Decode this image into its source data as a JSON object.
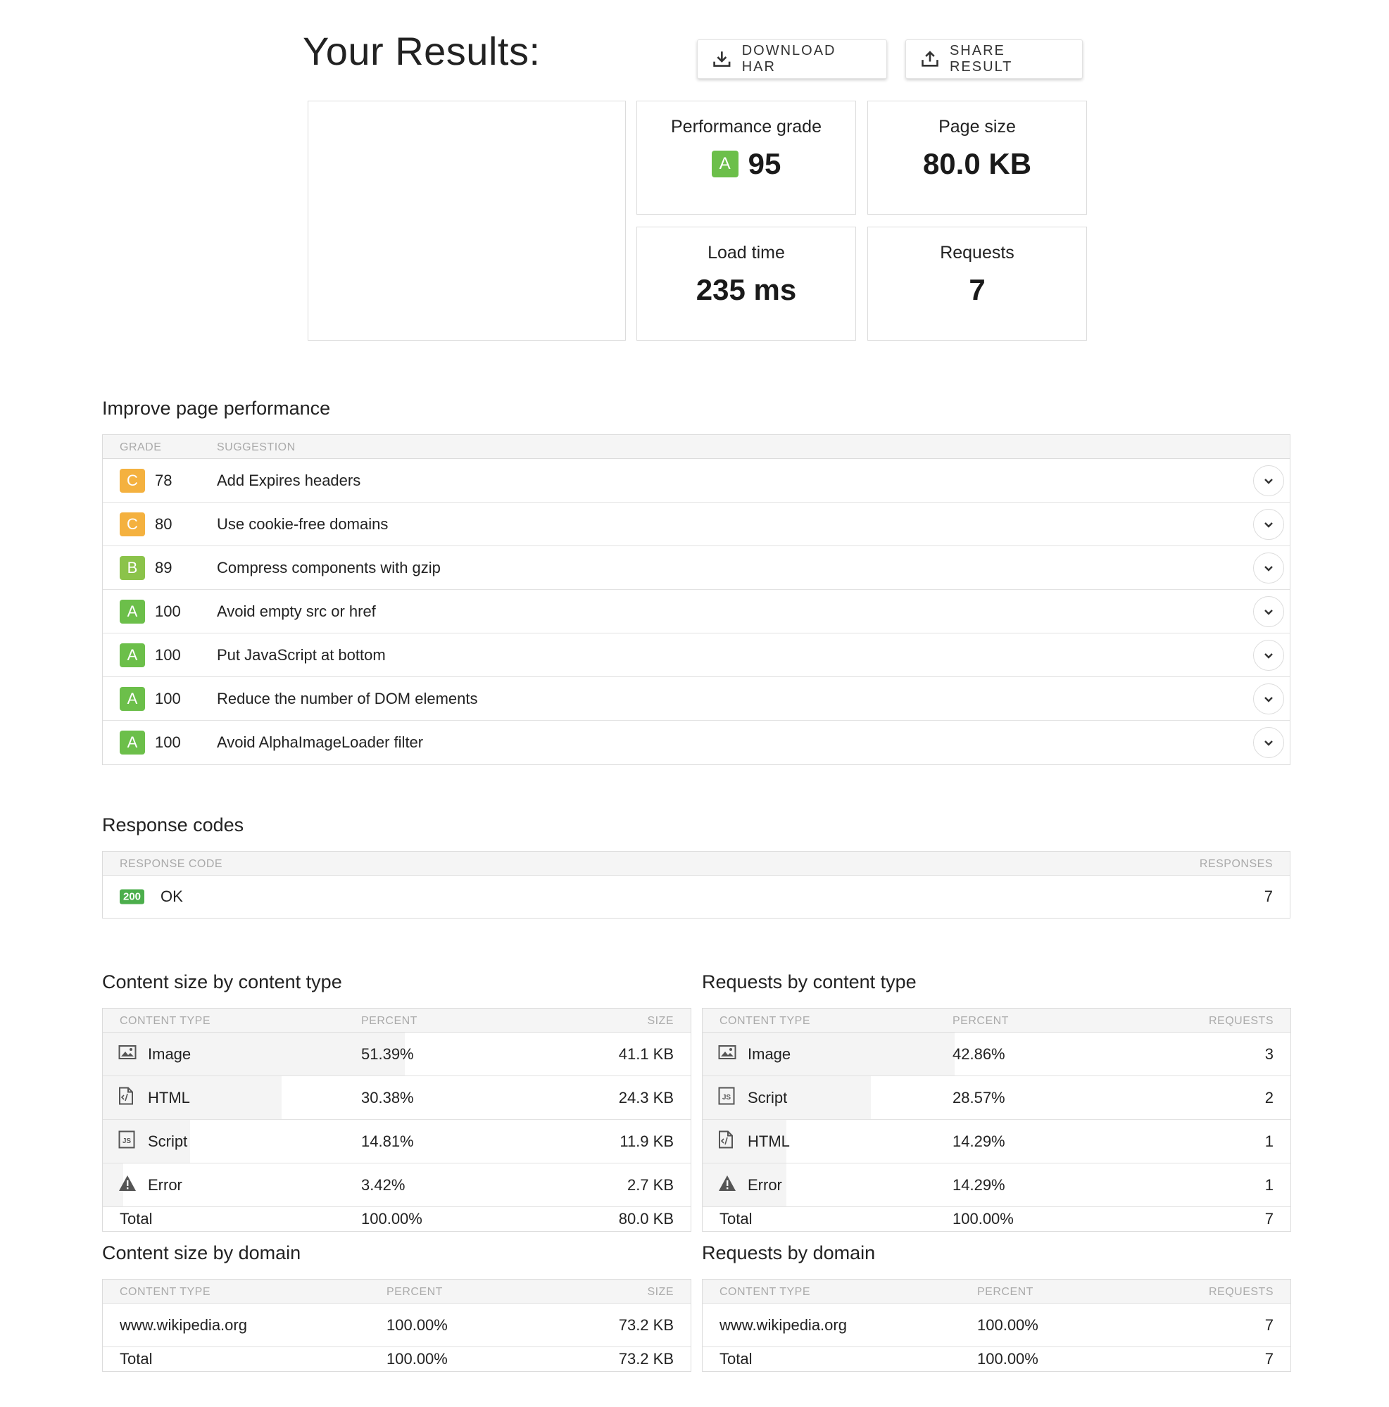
{
  "header": {
    "title": "Your Results:",
    "download_label": "DOWNLOAD HAR",
    "share_label": "SHARE RESULT"
  },
  "summary": {
    "grade_label": "Performance grade",
    "grade_letter": "A",
    "grade_value": "95",
    "size_label": "Page size",
    "size_value": "80.0 KB",
    "load_label": "Load time",
    "load_value": "235 ms",
    "requests_label": "Requests",
    "requests_value": "7"
  },
  "improve": {
    "title": "Improve page performance",
    "col_grade": "GRADE",
    "col_suggestion": "SUGGESTION",
    "rows": [
      {
        "letter": "C",
        "score": "78",
        "text": "Add Expires headers"
      },
      {
        "letter": "C",
        "score": "80",
        "text": "Use cookie-free domains"
      },
      {
        "letter": "B",
        "score": "89",
        "text": "Compress components with gzip"
      },
      {
        "letter": "A",
        "score": "100",
        "text": "Avoid empty src or href"
      },
      {
        "letter": "A",
        "score": "100",
        "text": "Put JavaScript at bottom"
      },
      {
        "letter": "A",
        "score": "100",
        "text": "Reduce the number of DOM elements"
      },
      {
        "letter": "A",
        "score": "100",
        "text": "Avoid AlphaImageLoader filter"
      }
    ]
  },
  "response_codes": {
    "title": "Response codes",
    "col_code": "RESPONSE CODE",
    "col_responses": "RESPONSES",
    "rows": [
      {
        "code": "200",
        "text": "OK",
        "responses": "7"
      }
    ]
  },
  "content_size": {
    "title": "Content size by content type",
    "col_type": "CONTENT TYPE",
    "col_percent": "PERCENT",
    "col_value": "SIZE",
    "rows": [
      {
        "icon": "image-icon",
        "type": "Image",
        "percent": "51.39%",
        "value": "41.1 KB",
        "fraction": 0.5139
      },
      {
        "icon": "html-file-icon",
        "type": "HTML",
        "percent": "30.38%",
        "value": "24.3 KB",
        "fraction": 0.3038
      },
      {
        "icon": "script-file-icon",
        "type": "Script",
        "percent": "14.81%",
        "value": "11.9 KB",
        "fraction": 0.1481
      },
      {
        "icon": "warning-icon",
        "type": "Error",
        "percent": "3.42%",
        "value": "2.7 KB",
        "fraction": 0.0342
      }
    ],
    "total": {
      "label": "Total",
      "percent": "100.00%",
      "value": "80.0 KB"
    }
  },
  "content_requests": {
    "title": "Requests by content type",
    "col_type": "CONTENT TYPE",
    "col_percent": "PERCENT",
    "col_value": "REQUESTS",
    "rows": [
      {
        "icon": "image-icon",
        "type": "Image",
        "percent": "42.86%",
        "value": "3",
        "fraction": 0.4286
      },
      {
        "icon": "script-file-icon",
        "type": "Script",
        "percent": "28.57%",
        "value": "2",
        "fraction": 0.2857
      },
      {
        "icon": "html-file-icon",
        "type": "HTML",
        "percent": "14.29%",
        "value": "1",
        "fraction": 0.1429
      },
      {
        "icon": "warning-icon",
        "type": "Error",
        "percent": "14.29%",
        "value": "1",
        "fraction": 0.1429
      }
    ],
    "total": {
      "label": "Total",
      "percent": "100.00%",
      "value": "7"
    }
  },
  "domain_size": {
    "title": "Content size by domain",
    "col_type": "CONTENT TYPE",
    "col_percent": "PERCENT",
    "col_value": "SIZE",
    "rows": [
      {
        "domain": "www.wikipedia.org",
        "percent": "100.00%",
        "value": "73.2 KB",
        "fraction": 1.0
      }
    ],
    "total": {
      "label": "Total",
      "percent": "100.00%",
      "value": "73.2 KB"
    }
  },
  "domain_requests": {
    "title": "Requests by domain",
    "col_type": "CONTENT TYPE",
    "col_percent": "PERCENT",
    "col_value": "REQUESTS",
    "rows": [
      {
        "domain": "www.wikipedia.org",
        "percent": "100.00%",
        "value": "7",
        "fraction": 1.0
      }
    ],
    "total": {
      "label": "Total",
      "percent": "100.00%",
      "value": "7"
    }
  },
  "colors": {
    "grade_a": "#6cbf4a",
    "grade_b": "#8bc34a",
    "grade_c": "#f4b13f",
    "status_ok": "#4cae4c"
  }
}
